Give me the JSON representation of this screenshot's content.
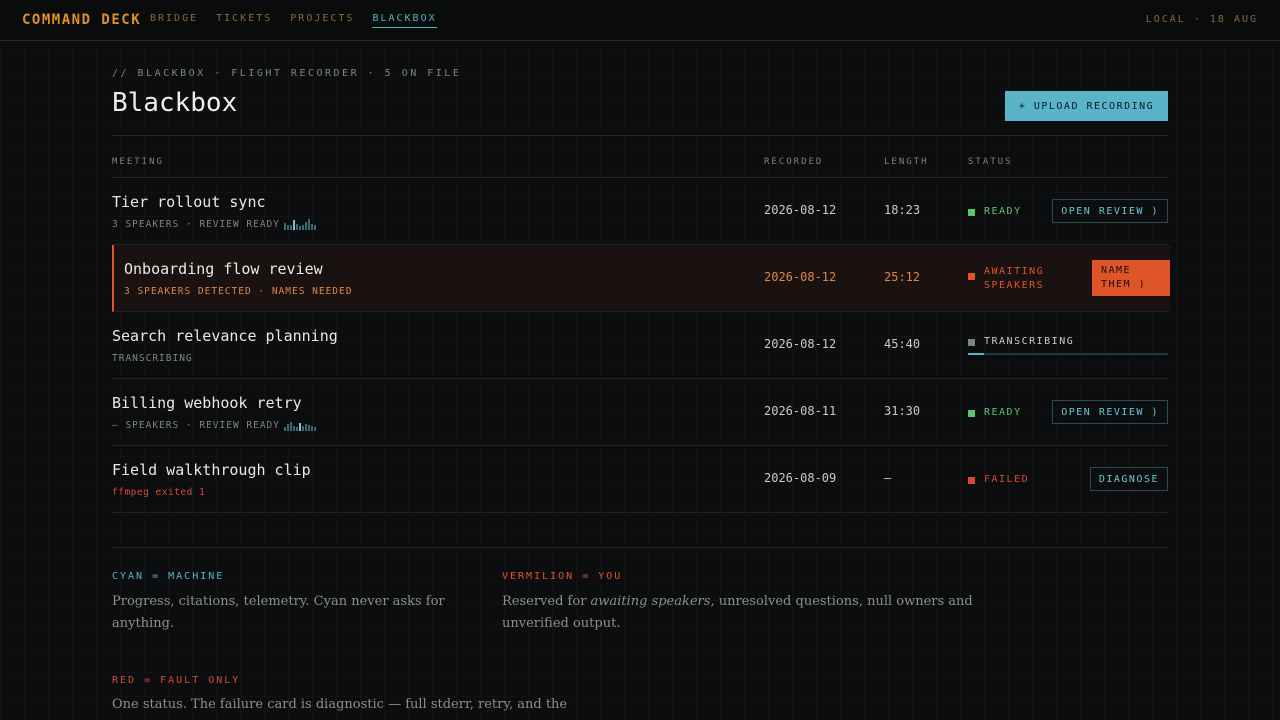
{
  "header": {
    "brand": "COMMAND DECK",
    "nav": [
      "BRIDGE",
      "TICKETS",
      "PROJECTS",
      "BLACKBOX"
    ],
    "active_nav": "BLACKBOX",
    "clock": "LOCAL · 18 AUG"
  },
  "page": {
    "kicker": "// BLACKBOX · FLIGHT RECORDER · 5 ON FILE",
    "title": "Blackbox",
    "upload_label": "+ UPLOAD RECORDING"
  },
  "table": {
    "headers": {
      "meeting": "MEETING",
      "recorded": "RECORDED",
      "length": "LENGTH",
      "status": "STATUS"
    },
    "rows": [
      {
        "title": "Tier rollout sync",
        "sub": "3 SPEAKERS · REVIEW READY",
        "recorded": "2026-08-12",
        "length": "18:23",
        "status": "READY",
        "action": "OPEN REVIEW )"
      },
      {
        "title": "Onboarding flow review",
        "sub": "3 SPEAKERS DETECTED · NAMES NEEDED",
        "recorded": "2026-08-12",
        "length": "25:12",
        "status_line1": "AWAITING",
        "status_line2": "SPEAKERS",
        "action_line1": "NAME",
        "action_line2": "THEM )"
      },
      {
        "title": "Search relevance planning",
        "sub": "TRANSCRIBING",
        "recorded": "2026-08-12",
        "length": "45:40",
        "status": "TRANSCRIBING",
        "progress": 0.08
      },
      {
        "title": "Billing webhook retry",
        "sub": "— SPEAKERS · REVIEW READY",
        "recorded": "2026-08-11",
        "length": "31:30",
        "status": "READY",
        "action": "OPEN REVIEW )"
      },
      {
        "title": "Field walkthrough clip",
        "sub": "ffmpeg exited 1",
        "recorded": "2026-08-09",
        "length": "—",
        "status": "FAILED",
        "action": "DIAGNOSE"
      }
    ]
  },
  "legend": {
    "cyan_label": "CYAN = MACHINE",
    "cyan_text": "Progress, citations, telemetry. Cyan never asks for anything.",
    "vermilion_label": "VERMILION = YOU",
    "vermilion_pre": "Reserved for ",
    "vermilion_em": "awaiting speakers",
    "vermilion_post": ", unresolved questions, null owners and unverified output.",
    "red_label": "RED = FAULT ONLY",
    "red_text": "One status. The failure card is diagnostic — full stderr, retry, and the"
  },
  "colors": {
    "accent_cyan": "#5ab4c8",
    "vermilion": "#e0542a",
    "fault_red": "#d8493a",
    "ready_green": "#5cc46a",
    "brand_amber": "#e0902a"
  }
}
